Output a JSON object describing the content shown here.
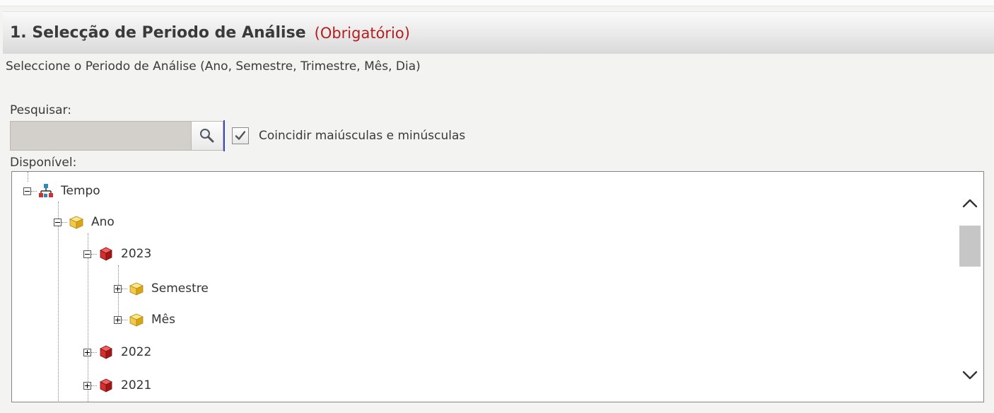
{
  "section": {
    "title": "1. Selecção de Periodo de Análise",
    "required_tag": "(Obrigatório)",
    "instruction": "Seleccione o Periodo de Análise (Ano, Semestre, Trimestre, Mês, Dia)"
  },
  "search": {
    "label": "Pesquisar:",
    "value": "",
    "placeholder": "",
    "button_icon": "magnifier-icon"
  },
  "match_case": {
    "checked": true,
    "label": "Coincidir maiúsculas e minúsculas"
  },
  "available": {
    "label": "Disponível:",
    "tree": [
      {
        "label": "Tempo",
        "expanded": true,
        "icon": "hierarchy-icon"
      },
      {
        "label": "Ano",
        "expanded": true,
        "icon": "yellow-cube-icon"
      },
      {
        "label": "2023",
        "expanded": true,
        "icon": "red-cube-icon"
      },
      {
        "label": "Semestre",
        "expanded": false,
        "icon": "yellow-cube-icon"
      },
      {
        "label": "Mês",
        "expanded": false,
        "icon": "yellow-cube-icon"
      },
      {
        "label": "2022",
        "expanded": false,
        "icon": "red-cube-icon"
      },
      {
        "label": "2021",
        "expanded": false,
        "icon": "red-cube-icon"
      }
    ]
  },
  "colors": {
    "required": "#b21f1f",
    "panel_bg": "#f3f3f2",
    "yellow_cube": "#f2c94c",
    "red_cube": "#d32f2f"
  }
}
